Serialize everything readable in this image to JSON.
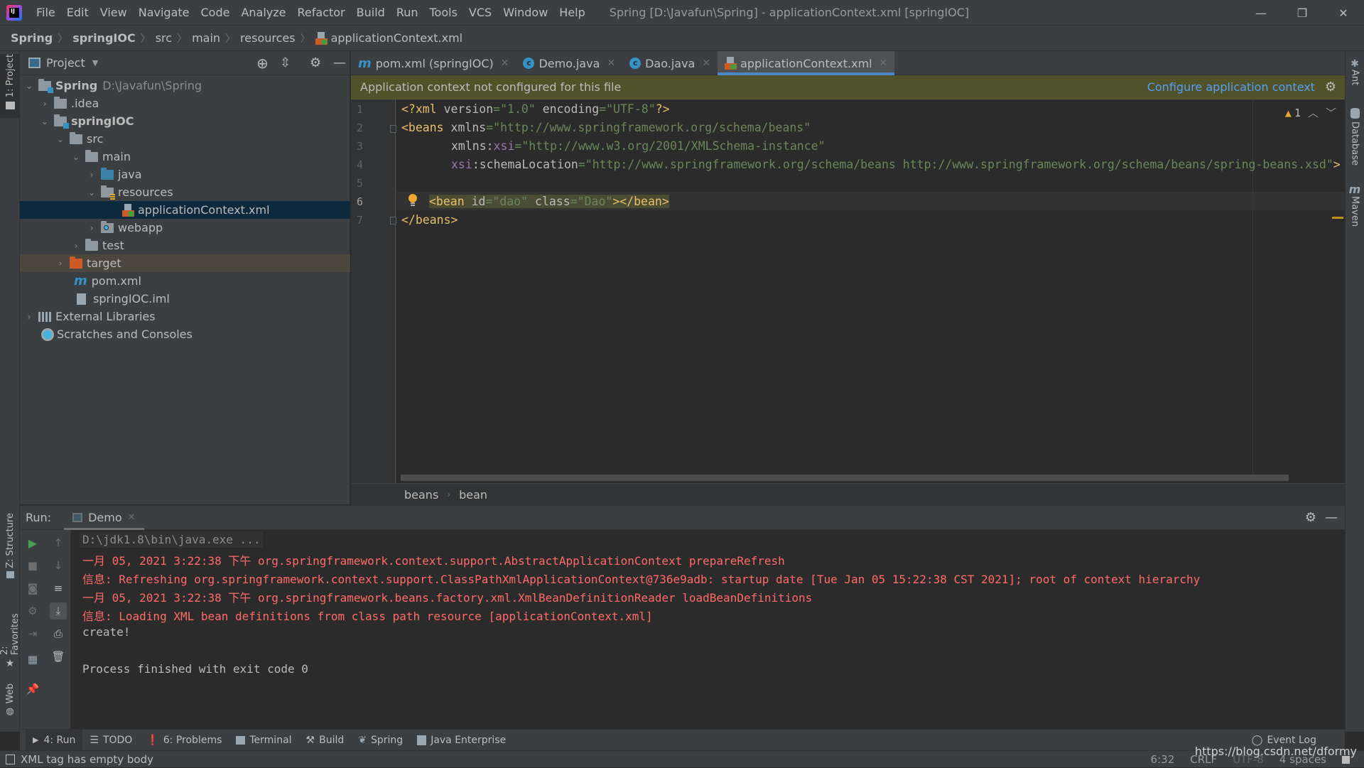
{
  "menu": {
    "items": [
      "File",
      "Edit",
      "View",
      "Navigate",
      "Code",
      "Analyze",
      "Refactor",
      "Build",
      "Run",
      "Tools",
      "VCS",
      "Window",
      "Help"
    ],
    "window_title": "Spring [D:\\Javafun\\Spring] - applicationContext.xml [springIOC]"
  },
  "breadcrumb": {
    "items": [
      "Spring",
      "springIOC",
      "src",
      "main",
      "resources",
      "applicationContext.xml"
    ]
  },
  "toolbar": {
    "run_config": "Demo"
  },
  "left_stripe": {
    "project_tab": "1: Project",
    "structure_tab": "Z: Structure",
    "favorites_tab": "2: Favorites",
    "web_tab": "Web"
  },
  "right_stripe": {
    "ant": "Ant",
    "database": "Database",
    "maven": "Maven"
  },
  "project_panel": {
    "title": "Project",
    "tree": [
      {
        "label": "Spring",
        "path": "D:\\Javafun\\Spring"
      },
      {
        "label": ".idea"
      },
      {
        "label": "springIOC"
      },
      {
        "label": "src"
      },
      {
        "label": "main"
      },
      {
        "label": "java"
      },
      {
        "label": "resources"
      },
      {
        "label": "applicationContext.xml"
      },
      {
        "label": "webapp"
      },
      {
        "label": "test"
      },
      {
        "label": "target"
      },
      {
        "label": "pom.xml"
      },
      {
        "label": "springIOC.iml"
      },
      {
        "label": "External Libraries"
      },
      {
        "label": "Scratches and Consoles"
      }
    ]
  },
  "editor_tabs": [
    {
      "label": "pom.xml (springIOC)"
    },
    {
      "label": "Demo.java"
    },
    {
      "label": "Dao.java"
    },
    {
      "label": "applicationContext.xml",
      "active": true
    }
  ],
  "banner": {
    "message": "Application context not configured for this file",
    "link": "Configure application context"
  },
  "editor": {
    "line_numbers": [
      "1",
      "2",
      "3",
      "4",
      "5",
      "6",
      "7"
    ],
    "lines": {
      "l1": {
        "a": "<?xml ",
        "b": "version",
        "c": "=\"1.0\" ",
        "d": "encoding",
        "e": "=\"UTF-8\"",
        "f": "?>"
      },
      "l2": {
        "tag": "<beans ",
        "attr": "xmlns",
        "val": "=\"http://www.springframework.org/schema/beans\""
      },
      "l3": {
        "attr": "xmlns:",
        "ns": "xsi",
        "val": "=\"http://www.w3.org/2001/XMLSchema-instance\""
      },
      "l4": {
        "ns": "xsi",
        "attr": ":schemaLocation",
        "val": "=\"http://www.springframework.org/schema/beans http://www.springframework.org/schema/beans/spring-beans.xsd\"",
        "tag": ">"
      },
      "l6": {
        "t1": "<bean ",
        "a1": "id",
        "v1": "=\"dao\" ",
        "a2": "class",
        "v2": "=\"Dao\"",
        "t2": "></bean>"
      },
      "l7": {
        "tag": "</beans>"
      }
    },
    "warning_count": "1",
    "breadcrumbs": [
      "beans",
      "bean"
    ]
  },
  "run_panel": {
    "label": "Run:",
    "tab": "Demo",
    "console": [
      {
        "text": "D:\\jdk1.8\\bin\\java.exe ...",
        "kind": "cmd"
      },
      {
        "text": "一月 05, 2021 3:22:38 下午 org.springframework.context.support.AbstractApplicationContext prepareRefresh",
        "kind": "err"
      },
      {
        "text": "信息: Refreshing org.springframework.context.support.ClassPathXmlApplicationContext@736e9adb: startup date [Tue Jan 05 15:22:38 CST 2021]; root of context hierarchy",
        "kind": "err"
      },
      {
        "text": "一月 05, 2021 3:22:38 下午 org.springframework.beans.factory.xml.XmlBeanDefinitionReader loadBeanDefinitions",
        "kind": "err"
      },
      {
        "text": "信息: Loading XML bean definitions from class path resource [applicationContext.xml]",
        "kind": "err"
      },
      {
        "text": "create!",
        "kind": "out"
      },
      {
        "text": "",
        "kind": "out"
      },
      {
        "text": "Process finished with exit code 0",
        "kind": "out"
      }
    ]
  },
  "bottom_tools": [
    {
      "label": "4: Run",
      "active": true
    },
    {
      "label": "TODO"
    },
    {
      "label": "6: Problems"
    },
    {
      "label": "Terminal"
    },
    {
      "label": "Build"
    },
    {
      "label": "Spring"
    },
    {
      "label": "Java Enterprise"
    }
  ],
  "event_log": "Event Log",
  "status": {
    "message": "XML tag has empty body",
    "position": "6:32",
    "line_sep": "CRLF",
    "encoding": "UTF-8",
    "indent": "4 spaces"
  },
  "watermark": "https://blog.csdn.net/dformy",
  "colors": {
    "accent": "#4a88c7",
    "banner_bg": "#50522a",
    "link": "#589df6",
    "error_text": "#ff6b68",
    "run_green": "#499c54"
  }
}
